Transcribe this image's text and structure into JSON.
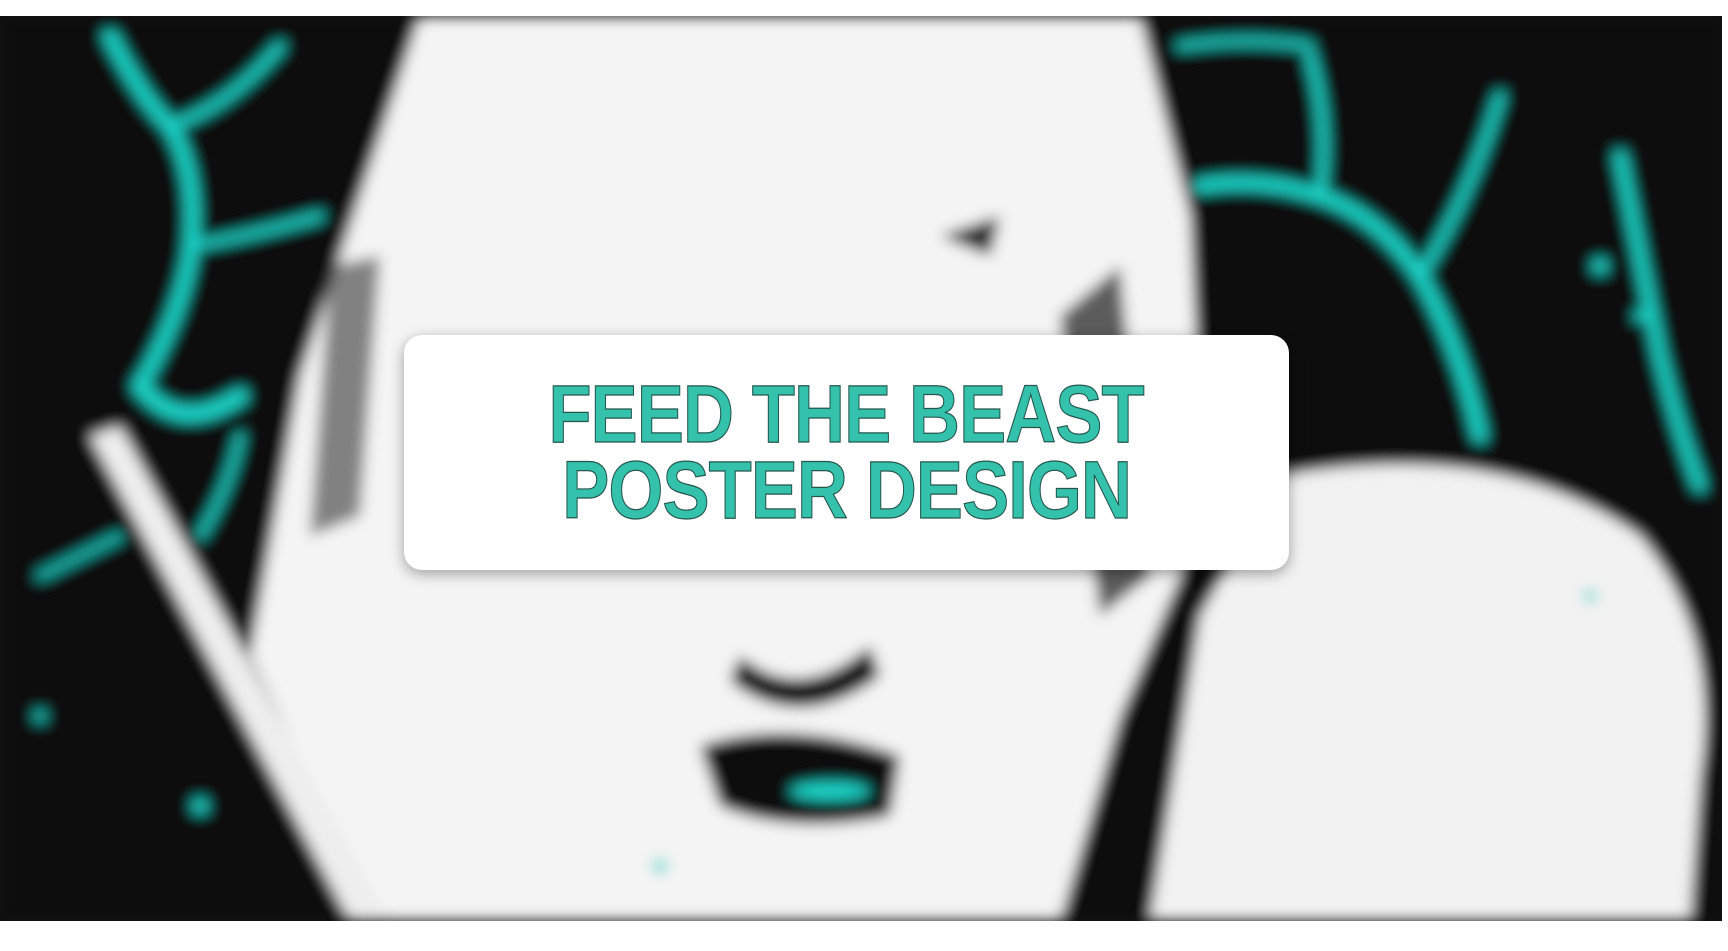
{
  "poster": {
    "title_lines": [
      "FEED THE BEAST",
      "POSTER DESIGN"
    ],
    "colors": {
      "accent": "#35c2ac",
      "background": "#0a0a0a",
      "figure": "#f5f5f5",
      "veins": "#1fd6c9"
    }
  }
}
